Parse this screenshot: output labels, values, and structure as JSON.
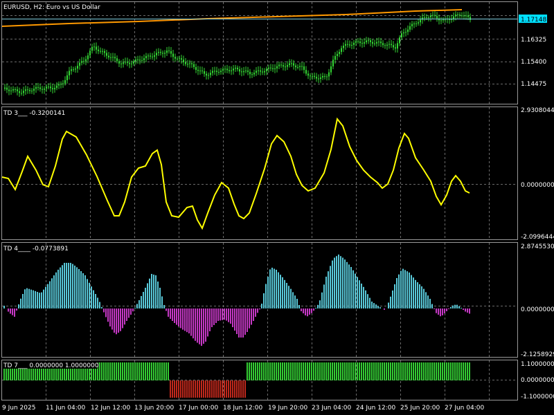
{
  "window": {
    "title": "EURUSD, H2:  Euro vs US Dollar"
  },
  "colors": {
    "background": "#000000",
    "grid": "#6b6b6b",
    "frame": "#9a9a9a",
    "text": "#ffffff",
    "candle": "#33d633",
    "moving_average": "#ff9900",
    "bid_line": "#7fd0e0",
    "bid_label_bg": "#00e0ff",
    "td3_line": "#ffff00",
    "td4_positive": "#58c8d8",
    "td4_negative": "#c438c4",
    "td7_positive": "#33cc33",
    "td7_negative": "#c0281c"
  },
  "main_panel": {
    "price_labels": [
      "1.16325",
      "1.15400",
      "1.14475"
    ],
    "current_price": "1.17148"
  },
  "td3_panel": {
    "label": "TD 3___ -0.3200141",
    "scale_labels": [
      "2.9308044",
      "0.0000000",
      "-2.0996444"
    ]
  },
  "td4_panel": {
    "label": "TD 4____ -0.0773891",
    "scale_labels": [
      "2.8745530",
      "0.0000000",
      "-2.1258929"
    ]
  },
  "td7_panel": {
    "label": "TD 7___ 0.0000000 1.0000000",
    "scale_labels": [
      "1.1000000",
      "0.0000000",
      "-1.1000000"
    ]
  },
  "time_axis": {
    "labels": [
      "9 Jun 2025",
      "11 Jun 04:00",
      "12 Jun 12:00",
      "13 Jun 20:00",
      "17 Jun 00:00",
      "18 Jun 12:00",
      "19 Jun 20:00",
      "23 Jun 04:00",
      "24 Jun 12:00",
      "25 Jun 20:00",
      "27 Jun 04:00"
    ]
  }
}
